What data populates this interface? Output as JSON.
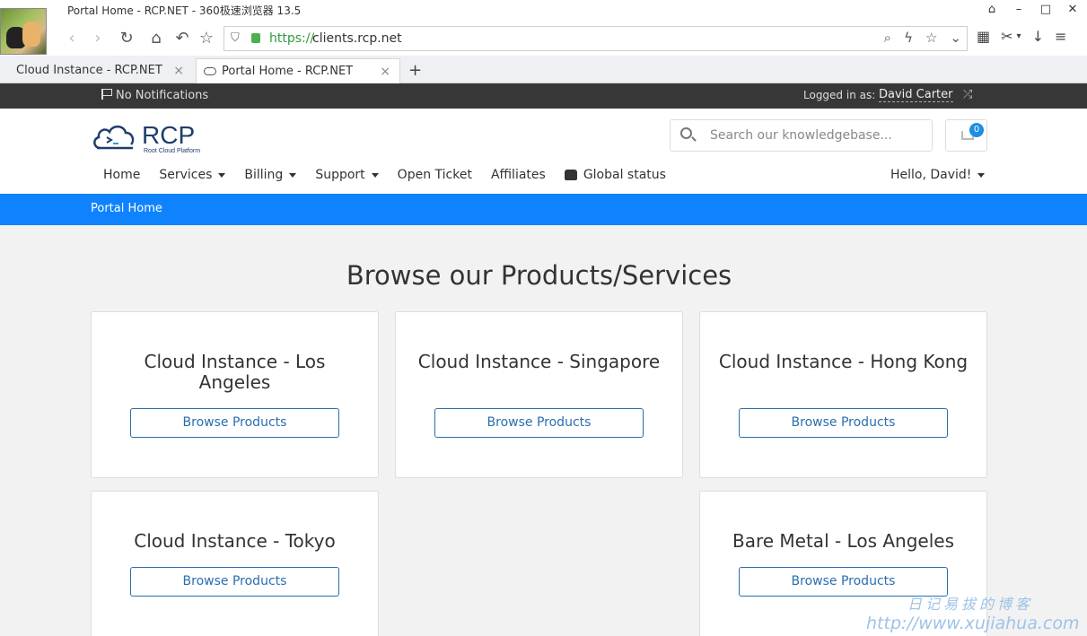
{
  "browser": {
    "window_title": "Portal Home - RCP.NET - 360极速浏览器 13.5",
    "url_scheme": "https://",
    "url_host": "clients.rcp.net",
    "tabs": [
      {
        "label": "Cloud Instance - RCP.NET",
        "active": false
      },
      {
        "label": "Portal Home - RCP.NET",
        "active": true
      }
    ],
    "new_tab_label": "+",
    "tab_close_label": "×"
  },
  "topbar": {
    "notifications": "No Notifications",
    "logged_in_label": "Logged in as:",
    "user_name": "David Carter"
  },
  "header": {
    "logo_text": "RCP",
    "logo_subtext": "Root Cloud Platform",
    "search_placeholder": "Search our knowledgebase...",
    "cart_count": "0"
  },
  "menu": {
    "items": [
      {
        "label": "Home",
        "dropdown": false
      },
      {
        "label": "Services",
        "dropdown": true
      },
      {
        "label": "Billing",
        "dropdown": true
      },
      {
        "label": "Support",
        "dropdown": true
      },
      {
        "label": "Open Ticket",
        "dropdown": false
      },
      {
        "label": "Affiliates",
        "dropdown": false
      },
      {
        "label": "Global status",
        "dropdown": false
      }
    ],
    "hello": "Hello, David!"
  },
  "breadcrumb": {
    "current": "Portal Home"
  },
  "main": {
    "heading": "Browse our Products/Services",
    "button_label": "Browse Products",
    "cards": [
      {
        "title": "Cloud Instance - Los Angeles"
      },
      {
        "title": "Cloud Instance - Singapore"
      },
      {
        "title": "Cloud Instance - Hong Kong"
      },
      {
        "title": "Cloud Instance - Tokyo"
      },
      {
        "title": "Bare Metal - Los Angeles"
      }
    ]
  },
  "watermark": {
    "line1": "日记易拔的博客",
    "line2": "http://www.xujiahua.com"
  },
  "colors": {
    "accent": "#0f83fd",
    "topbar": "#373737",
    "button_border": "#2a6db0",
    "cart_badge": "#1a8fe3"
  }
}
